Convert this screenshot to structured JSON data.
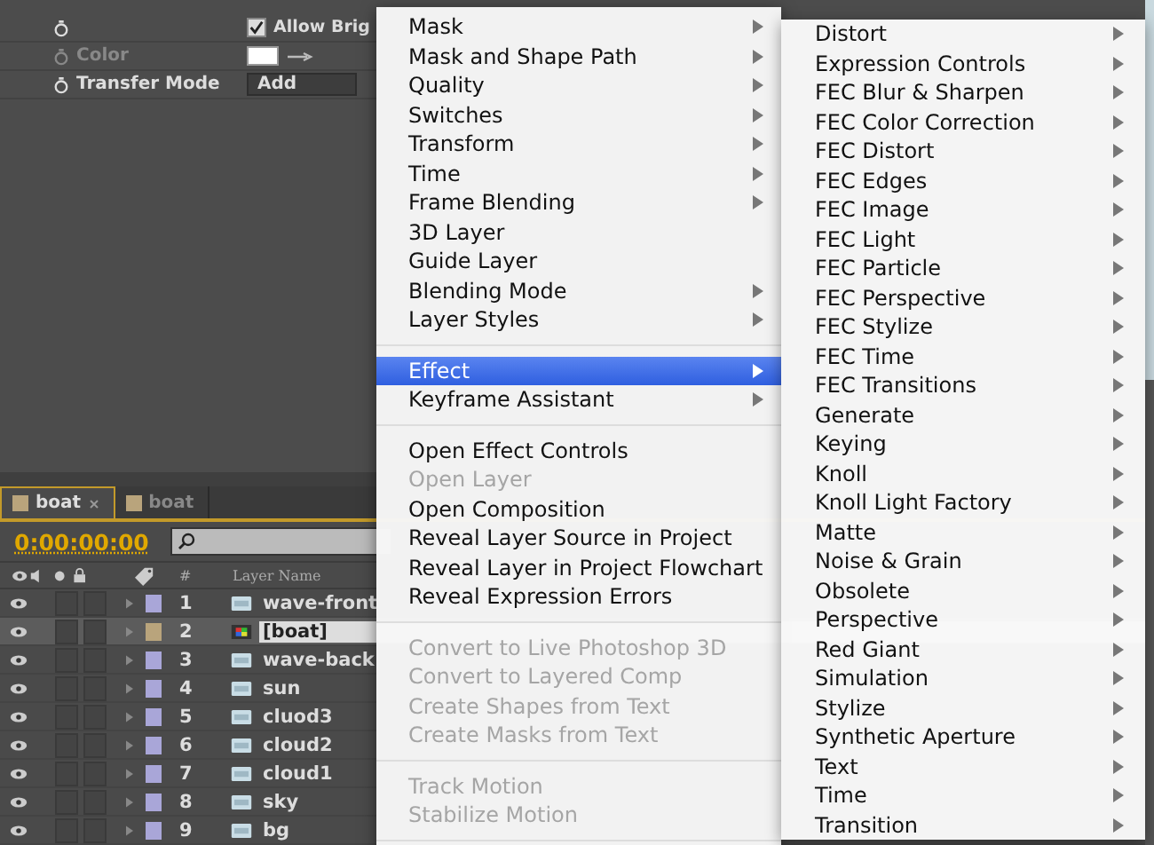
{
  "effect_properties": [
    {
      "kind": "checkbox",
      "value": "Allow Brig",
      "checked": true,
      "stopwatch": true,
      "disabled": false
    },
    {
      "label": "Color",
      "kind": "color",
      "stopwatch": true,
      "disabled": true
    },
    {
      "label": "Transfer Mode",
      "kind": "dropdown",
      "value": "Add",
      "stopwatch": true,
      "disabled": false
    }
  ],
  "timeline": {
    "tabs": [
      {
        "label": "boat",
        "selected": true,
        "closable": true
      },
      {
        "label": "boat",
        "selected": false,
        "closable": false
      }
    ],
    "timecode": "0:00:00:00",
    "columns": {
      "number": "#",
      "layer_name": "Layer Name"
    },
    "layers": [
      {
        "number": "1",
        "name": "wave-front",
        "kind": "footage",
        "color": "#a9a6d8",
        "selected": false
      },
      {
        "number": "2",
        "name": "[boat]",
        "kind": "comp",
        "color": "#b9a47c",
        "selected": true
      },
      {
        "number": "3",
        "name": "wave-back",
        "kind": "footage",
        "color": "#a9a6d8",
        "selected": false
      },
      {
        "number": "4",
        "name": "sun",
        "kind": "footage",
        "color": "#a9a6d8",
        "selected": false
      },
      {
        "number": "5",
        "name": "cluod3",
        "kind": "footage",
        "color": "#a9a6d8",
        "selected": false
      },
      {
        "number": "6",
        "name": "cloud2",
        "kind": "footage",
        "color": "#a9a6d8",
        "selected": false
      },
      {
        "number": "7",
        "name": "cloud1",
        "kind": "footage",
        "color": "#a9a6d8",
        "selected": false
      },
      {
        "number": "8",
        "name": "sky",
        "kind": "footage",
        "color": "#a9a6d8",
        "selected": false
      },
      {
        "number": "9",
        "name": "bg",
        "kind": "footage",
        "color": "#a9a6d8",
        "selected": false
      }
    ]
  },
  "context_menu": {
    "groups": [
      [
        {
          "label": "Mask",
          "submenu": true,
          "disabled": false,
          "selected": false
        },
        {
          "label": "Mask and Shape Path",
          "submenu": true,
          "disabled": false,
          "selected": false
        },
        {
          "label": "Quality",
          "submenu": true,
          "disabled": false,
          "selected": false
        },
        {
          "label": "Switches",
          "submenu": true,
          "disabled": false,
          "selected": false
        },
        {
          "label": "Transform",
          "submenu": true,
          "disabled": false,
          "selected": false
        },
        {
          "label": "Time",
          "submenu": true,
          "disabled": false,
          "selected": false
        },
        {
          "label": "Frame Blending",
          "submenu": true,
          "disabled": false,
          "selected": false
        },
        {
          "label": "3D Layer",
          "submenu": false,
          "disabled": false,
          "selected": false
        },
        {
          "label": "Guide Layer",
          "submenu": false,
          "disabled": false,
          "selected": false
        },
        {
          "label": "Blending Mode",
          "submenu": true,
          "disabled": false,
          "selected": false
        },
        {
          "label": "Layer Styles",
          "submenu": true,
          "disabled": false,
          "selected": false
        }
      ],
      [
        {
          "label": "Effect",
          "submenu": true,
          "disabled": false,
          "selected": true
        },
        {
          "label": "Keyframe Assistant",
          "submenu": true,
          "disabled": false,
          "selected": false
        }
      ],
      [
        {
          "label": "Open Effect Controls",
          "submenu": false,
          "disabled": false,
          "selected": false
        },
        {
          "label": "Open Layer",
          "submenu": false,
          "disabled": true,
          "selected": false
        },
        {
          "label": "Open Composition",
          "submenu": false,
          "disabled": false,
          "selected": false
        },
        {
          "label": "Reveal Layer Source in Project",
          "submenu": false,
          "disabled": false,
          "selected": false
        },
        {
          "label": "Reveal Layer in Project Flowchart",
          "submenu": false,
          "disabled": false,
          "selected": false
        },
        {
          "label": "Reveal Expression Errors",
          "submenu": false,
          "disabled": false,
          "selected": false
        }
      ],
      [
        {
          "label": "Convert to Live Photoshop 3D",
          "submenu": false,
          "disabled": true,
          "selected": false
        },
        {
          "label": "Convert to Layered Comp",
          "submenu": false,
          "disabled": true,
          "selected": false
        },
        {
          "label": "Create Shapes from Text",
          "submenu": false,
          "disabled": true,
          "selected": false
        },
        {
          "label": "Create Masks from Text",
          "submenu": false,
          "disabled": true,
          "selected": false
        }
      ],
      [
        {
          "label": "Track Motion",
          "submenu": false,
          "disabled": true,
          "selected": false
        },
        {
          "label": "Stabilize Motion",
          "submenu": false,
          "disabled": true,
          "selected": false
        }
      ]
    ]
  },
  "effect_submenu": {
    "items": [
      {
        "label": "Distort",
        "submenu": true
      },
      {
        "label": "Expression Controls",
        "submenu": true
      },
      {
        "label": "FEC Blur & Sharpen",
        "submenu": true
      },
      {
        "label": "FEC Color Correction",
        "submenu": true
      },
      {
        "label": "FEC Distort",
        "submenu": true
      },
      {
        "label": "FEC Edges",
        "submenu": true
      },
      {
        "label": "FEC Image",
        "submenu": true
      },
      {
        "label": "FEC Light",
        "submenu": true
      },
      {
        "label": "FEC Particle",
        "submenu": true
      },
      {
        "label": "FEC Perspective",
        "submenu": true
      },
      {
        "label": "FEC Stylize",
        "submenu": true
      },
      {
        "label": "FEC Time",
        "submenu": true
      },
      {
        "label": "FEC Transitions",
        "submenu": true
      },
      {
        "label": "Generate",
        "submenu": true
      },
      {
        "label": "Keying",
        "submenu": true
      },
      {
        "label": "Knoll",
        "submenu": true
      },
      {
        "label": "Knoll Light Factory",
        "submenu": true
      },
      {
        "label": "Matte",
        "submenu": true
      },
      {
        "label": "Noise & Grain",
        "submenu": true
      },
      {
        "label": "Obsolete",
        "submenu": true
      },
      {
        "label": "Perspective",
        "submenu": true
      },
      {
        "label": "Red Giant",
        "submenu": true
      },
      {
        "label": "Simulation",
        "submenu": true
      },
      {
        "label": "Stylize",
        "submenu": true
      },
      {
        "label": "Synthetic Aperture",
        "submenu": true
      },
      {
        "label": "Text",
        "submenu": true
      },
      {
        "label": "Time",
        "submenu": true
      },
      {
        "label": "Transition",
        "submenu": true
      }
    ]
  }
}
